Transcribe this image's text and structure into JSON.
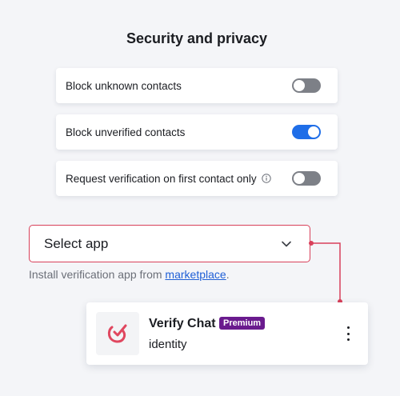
{
  "header": {
    "title": "Security and privacy"
  },
  "settings": [
    {
      "label": "Block unknown contacts",
      "enabled": false
    },
    {
      "label": "Block unverified contacts",
      "enabled": true
    },
    {
      "label": "Request verification on first contact only",
      "enabled": false,
      "has_info_icon": true
    }
  ],
  "select": {
    "value": "Select app",
    "icon": "chevron-down-icon"
  },
  "helper": {
    "prefix": "Install verification app from",
    "link": "marketplace",
    "suffix": "."
  },
  "app": {
    "name": "Verify Chat",
    "badge": "Premium",
    "subtitle": "identity",
    "menu_icon": "kebab-menu-icon"
  },
  "colors": {
    "accent_blue": "#1f6ee8",
    "toggle_off": "#7d8087",
    "highlight_red": "#d8405a",
    "premium_purple": "#6a1b8e",
    "link_blue": "#1f5fd6"
  }
}
